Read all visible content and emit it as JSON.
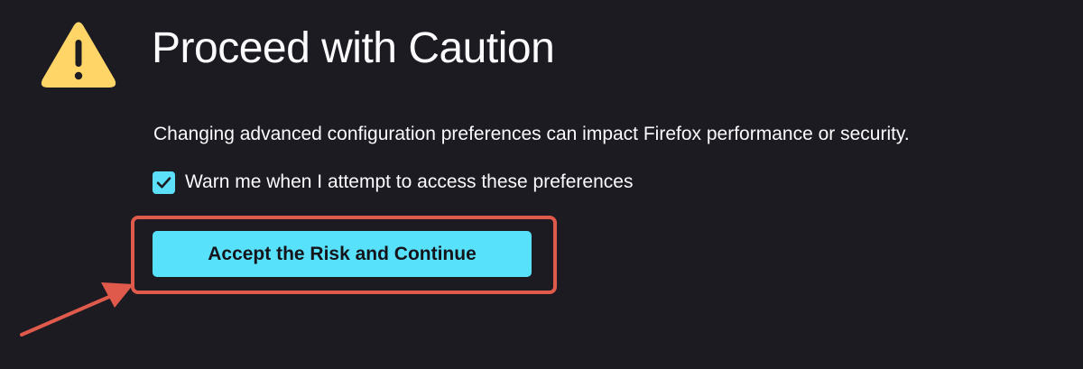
{
  "header": {
    "title": "Proceed with Caution",
    "icon": "warning-triangle-icon"
  },
  "main": {
    "description": "Changing advanced configuration preferences can impact Firefox performance or security.",
    "warn_checkbox": {
      "label": "Warn me when I attempt to access these preferences",
      "checked": true
    },
    "accept_button": {
      "label": "Accept the Risk and Continue"
    }
  },
  "annotation": {
    "highlight_target": "accept_button",
    "arrow_icon": "arrow-icon"
  },
  "colors": {
    "background": "#1c1b22",
    "text": "#fbfbfe",
    "accent": "#58e1fb",
    "warning": "#ffd567",
    "annotation": "#e05a4c"
  }
}
